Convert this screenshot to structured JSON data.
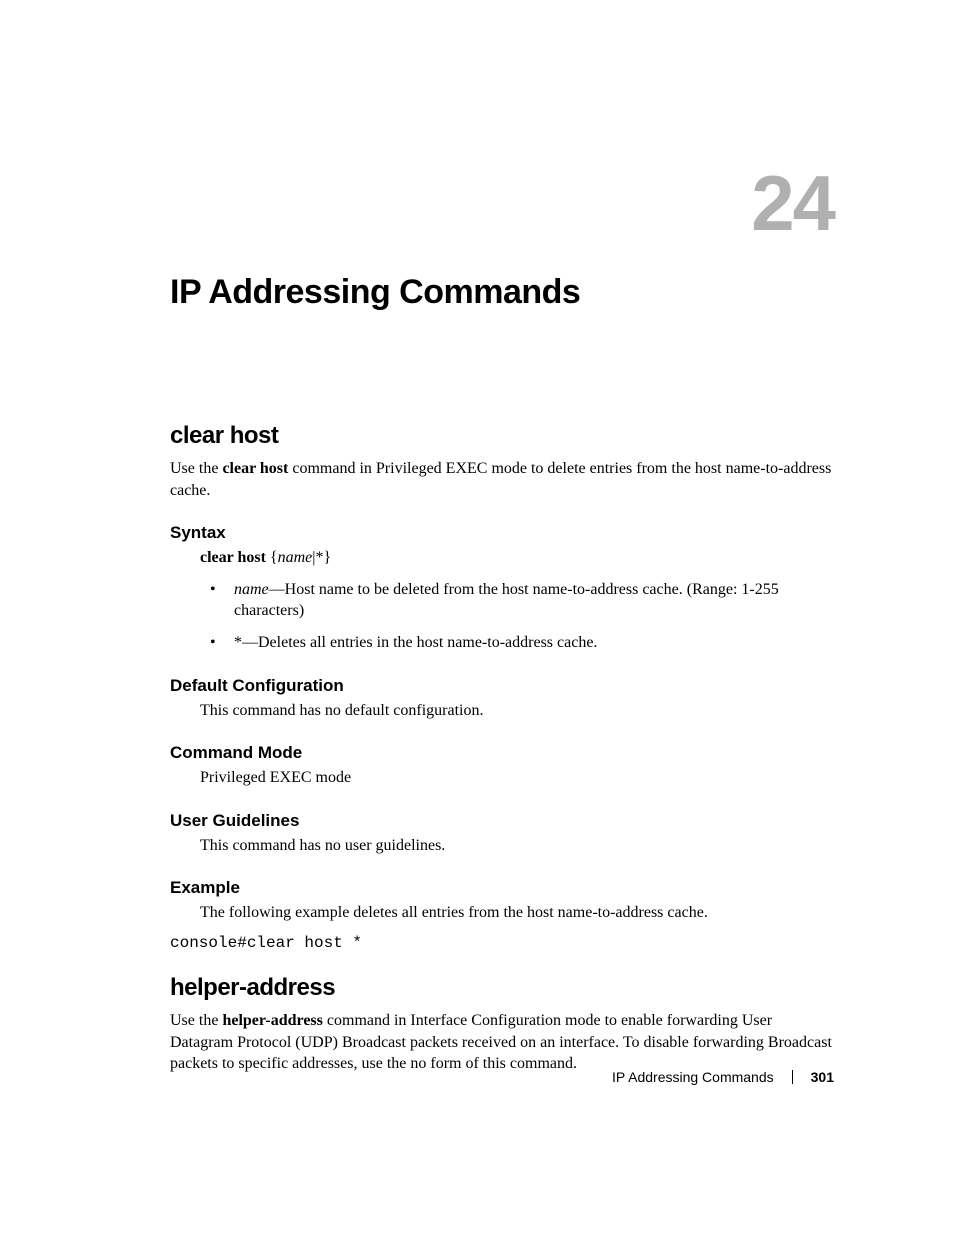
{
  "chapter": {
    "number": "24",
    "title": "IP Addressing Commands"
  },
  "sections": {
    "clear_host": {
      "title": "clear host",
      "intro_pre": "Use the ",
      "intro_cmd": "clear host",
      "intro_post": " command in Privileged EXEC mode to delete entries from the host name-to-address cache.",
      "syntax": {
        "heading": "Syntax",
        "line_cmd": "clear host",
        "line_args": " {",
        "line_name": "name",
        "line_end": "|*}",
        "bullet1_name": "name",
        "bullet1_text": "—Host name to be deleted from the host name-to-address cache. (Range: 1-255 characters)",
        "bullet2_star": "*",
        "bullet2_text": "—Deletes all entries in the host name-to-address cache."
      },
      "default_config": {
        "heading": "Default Configuration",
        "text": "This command has no default configuration."
      },
      "command_mode": {
        "heading": "Command Mode",
        "text": "Privileged EXEC mode"
      },
      "user_guidelines": {
        "heading": "User Guidelines",
        "text": "This command has no user guidelines."
      },
      "example": {
        "heading": "Example",
        "text": "The following example deletes all entries from the host name-to-address cache.",
        "code": "console#clear host *"
      }
    },
    "helper_address": {
      "title": "helper-address",
      "intro_pre": "Use the ",
      "intro_cmd": "helper-address",
      "intro_post": " command in Interface Configuration mode to enable forwarding User Datagram Protocol (UDP) Broadcast packets received on an interface. To disable forwarding Broadcast packets to specific addresses, use the no form of this command."
    }
  },
  "footer": {
    "chapter_name": "IP Addressing Commands",
    "page": "301"
  }
}
